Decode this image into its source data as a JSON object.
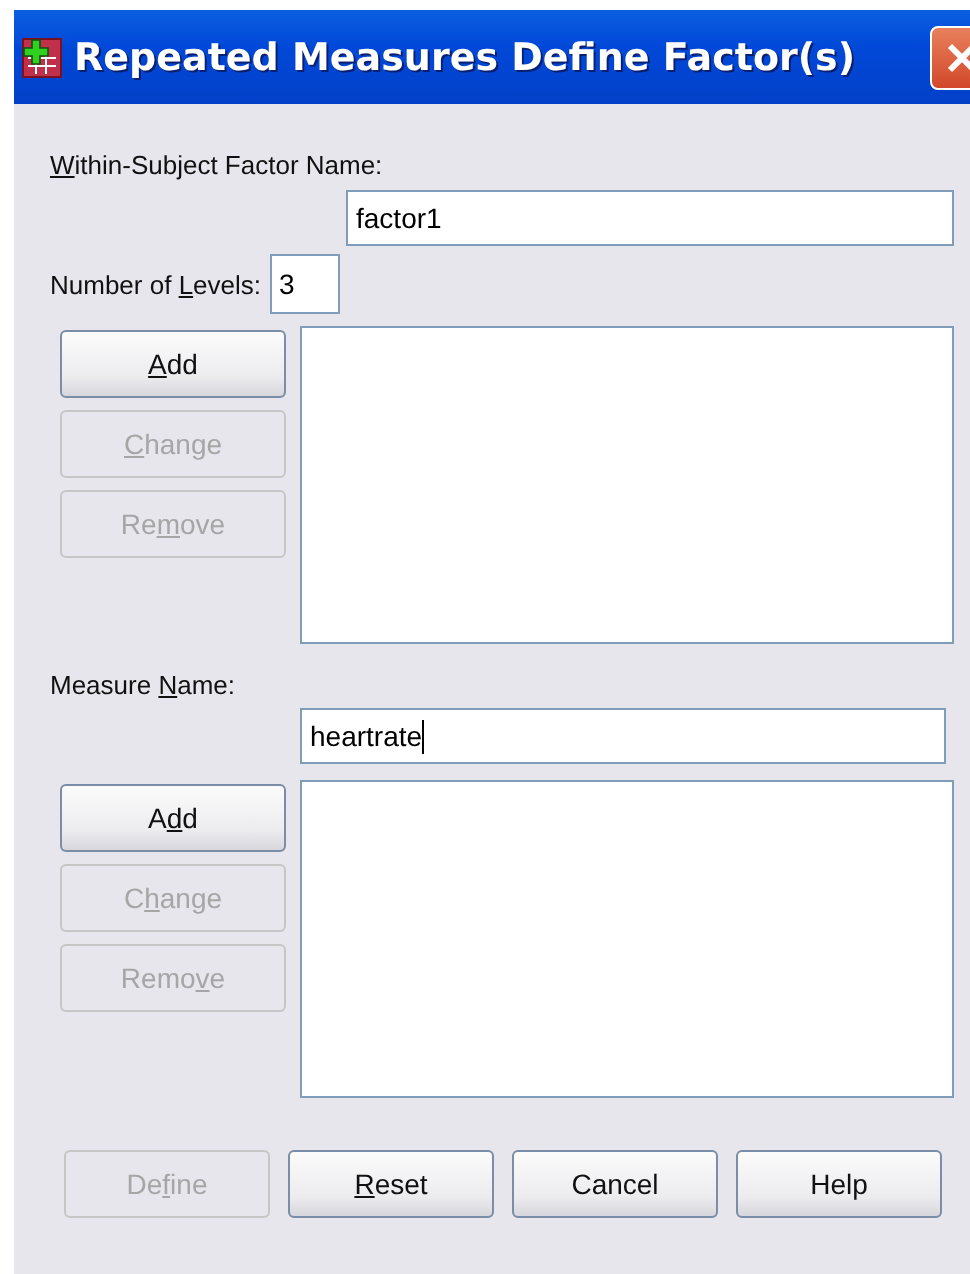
{
  "window": {
    "title": "Repeated Measures Define Factor(s)"
  },
  "factor_name": {
    "label": {
      "key": "W",
      "post": "ithin-Subject Factor Name:"
    },
    "value": "factor1"
  },
  "levels": {
    "label": {
      "pre": "Number of ",
      "key": "L",
      "post": "evels:"
    },
    "value": "3"
  },
  "factor_buttons": [
    {
      "label": {
        "key": "A",
        "post": "dd"
      },
      "disabled": false
    },
    {
      "label": {
        "key": "C",
        "post": "hange"
      },
      "disabled": true
    },
    {
      "label": {
        "pre": "Re",
        "key": "m",
        "post": "ove"
      },
      "disabled": true
    }
  ],
  "measure_name": {
    "label": {
      "pre": "Measure ",
      "key": "N",
      "post": "ame:"
    },
    "value": "heartrate",
    "focused": true
  },
  "measure_buttons": [
    {
      "label": {
        "pre": "A",
        "key": "d",
        "post": "d"
      },
      "disabled": false
    },
    {
      "label": {
        "pre": "C",
        "key": "h",
        "post": "ange"
      },
      "disabled": true
    },
    {
      "label": {
        "pre": "Remo",
        "key": "v",
        "post": "e"
      },
      "disabled": true
    }
  ],
  "buttons": [
    {
      "label": {
        "pre": "De",
        "key": "f",
        "post": "ine"
      },
      "disabled": true
    },
    {
      "label": {
        "key": "R",
        "post": "eset"
      },
      "disabled": false
    },
    {
      "label": {
        "pre": "Cancel"
      },
      "disabled": false
    },
    {
      "label": {
        "pre": "Help"
      },
      "disabled": false
    }
  ]
}
